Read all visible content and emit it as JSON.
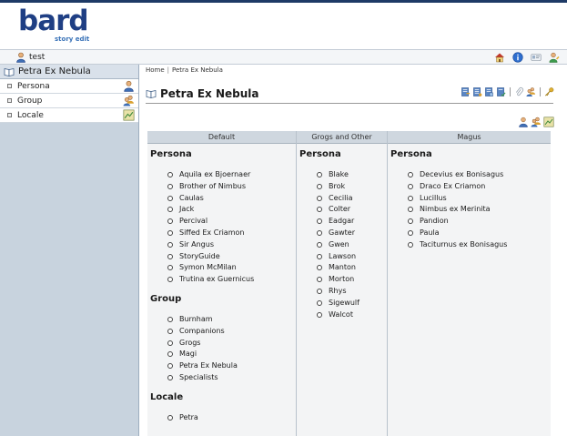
{
  "app": {
    "logo": "bard",
    "logo_sub": "story edit"
  },
  "userbar": {
    "username": "test",
    "tools": [
      "home-icon",
      "info-icon",
      "id-card-icon",
      "user-edit-icon"
    ]
  },
  "sidebar": {
    "root": "Petra Ex Nebula",
    "items": [
      {
        "label": "Persona",
        "icon": "persona-icon"
      },
      {
        "label": "Group",
        "icon": "group-icon"
      },
      {
        "label": "Locale",
        "icon": "map-icon"
      }
    ]
  },
  "main": {
    "breadcrumb": [
      "Home",
      "Petra Ex Nebula"
    ],
    "breadcrumb_sep": "|",
    "title": "Petra Ex Nebula",
    "title_tools": [
      "edit-doc-icon",
      "doc-list-icon",
      "doc-copy-icon",
      "doc-check-icon",
      "attach-icon",
      "users-icon",
      "key-icon"
    ],
    "table_tools": [
      "add-persona-icon",
      "add-group-icon",
      "add-locale-icon"
    ],
    "columns": [
      {
        "header": "Default",
        "sections": [
          {
            "title": "Persona",
            "items": [
              "Aquila ex Bjoernaer",
              "Brother of Nimbus",
              "Caulas",
              "Jack",
              "Percival",
              "Siffed Ex Criamon",
              "Sir Angus",
              "StoryGuide",
              "Symon McMilan",
              "Trutina ex Guernicus"
            ]
          },
          {
            "title": "Group",
            "items": [
              "Burnham",
              "Companions",
              "Grogs",
              "Magi",
              "Petra Ex Nebula",
              "Specialists"
            ]
          },
          {
            "title": "Locale",
            "items": [
              "Petra"
            ]
          }
        ]
      },
      {
        "header": "Grogs and Other",
        "sections": [
          {
            "title": "Persona",
            "items": [
              "Blake",
              "Brok",
              "Cecilia",
              "Colter",
              "Eadgar",
              "Gawter",
              "Gwen",
              "Lawson",
              "Manton",
              "Morton",
              "Rhys",
              "Sigewulf",
              "Walcot"
            ]
          }
        ]
      },
      {
        "header": "Magus",
        "sections": [
          {
            "title": "Persona",
            "items": [
              "Decevius ex Bonisagus",
              "Draco Ex Criamon",
              "Lucillus",
              "Nimbus ex Merinita",
              "Pandion",
              "Paula",
              "Taciturnus ex Bonisagus"
            ]
          }
        ]
      }
    ]
  }
}
